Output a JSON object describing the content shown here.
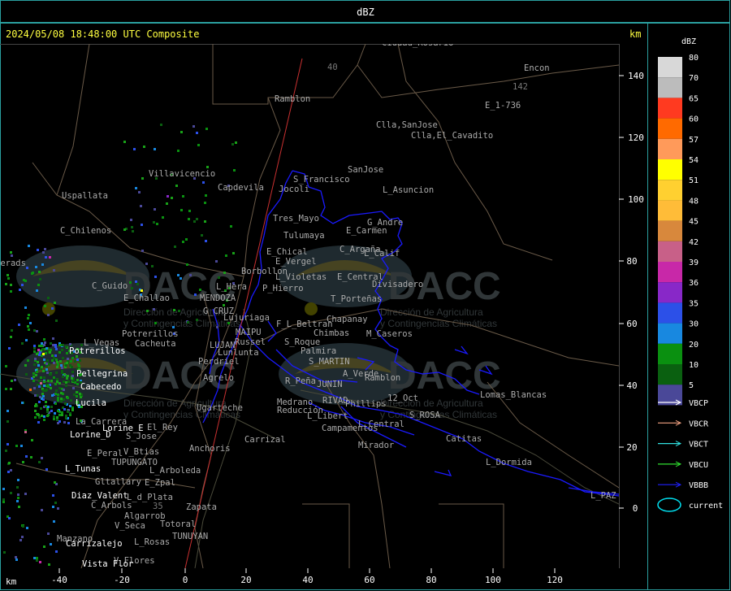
{
  "header": {
    "title": "dBZ",
    "timestamp": "2024/05/08 18:48:00 UTC Composite",
    "unit_top": "km",
    "unit_bottom": "km"
  },
  "axes": {
    "x_ticks": [
      "-40",
      "-20",
      "0",
      "20",
      "40",
      "60",
      "80",
      "100",
      "120"
    ],
    "y_ticks": [
      "140",
      "120",
      "100",
      "80",
      "60",
      "40",
      "20",
      "0"
    ]
  },
  "legend": {
    "title": "dBZ",
    "bins": [
      {
        "label": "80",
        "color": "#d8d8d8"
      },
      {
        "label": "70",
        "color": "#bcbcbc"
      },
      {
        "label": "65",
        "color": "#ff3a20"
      },
      {
        "label": "60",
        "color": "#ff6a00"
      },
      {
        "label": "57",
        "color": "#ff9a5a"
      },
      {
        "label": "54",
        "color": "#ffff00"
      },
      {
        "label": "51",
        "color": "#ffd030"
      },
      {
        "label": "48",
        "color": "#ffbc38"
      },
      {
        "label": "45",
        "color": "#d8883c"
      },
      {
        "label": "42",
        "color": "#c86088"
      },
      {
        "label": "39",
        "color": "#c828a8"
      },
      {
        "label": "36",
        "color": "#8828c8"
      },
      {
        "label": "35",
        "color": "#2c50e8"
      },
      {
        "label": "30",
        "color": "#1888e0"
      },
      {
        "label": "20",
        "color": "#0a9010"
      },
      {
        "label": "10",
        "color": "#0a6010"
      },
      {
        "label": "5",
        "color": "#4a4898"
      }
    ],
    "lines": [
      {
        "label": "VBCP",
        "color": "#ffffff"
      },
      {
        "label": "VBCR",
        "color": "#f0a080"
      },
      {
        "label": "VBCT",
        "color": "#30e0e0"
      },
      {
        "label": "VBCU",
        "color": "#30e030"
      },
      {
        "label": "VBBB",
        "color": "#2020ff"
      }
    ],
    "current_label": "current",
    "current_color": "#00e0f0"
  },
  "watermark": {
    "brand": "DACC",
    "line1": "Dirección de Agricultura",
    "line2": "y Contingencias Climáticas"
  },
  "places_white": [
    "Potrerillos",
    "Pellegrina",
    "Cabecedo",
    "Lucila",
    "Lorine_D",
    "Lorine_E",
    "L_Tunas",
    "Diaz_Valent",
    "Carrizalejo",
    "Vista_Flor"
  ],
  "places_gray": [
    "Ciudad_Rosario",
    "Encon",
    "142",
    "E_1-736",
    "Ramblon",
    "Clla,SanJose",
    "Clla,El_Cavadito",
    "SanJose",
    "S_Francisco",
    "Jocoli",
    "Villavicencio",
    "Capdevila",
    "L_Asuncion",
    "Uspallata",
    "Tres_Mayo",
    "G_Andre",
    "Tulumaya",
    "E_Carmen",
    "C_Chilenos",
    "E_Chical",
    "C_Argaña",
    "L_Calif",
    "E_Vergel",
    "Borbollon",
    "L_Violetas",
    "E_Central",
    "Divisadero",
    "C_Guido",
    "L_Hera",
    "P_Hierro",
    "E_Challao",
    "MENDOZA",
    "T_Porteñas",
    "G_CRUZ",
    "Lujuriaga",
    "Chapanay",
    "Potrerillos",
    "F_L_Beltran",
    "MAIPU",
    "Chimbas",
    "M_Caseros",
    "Cacheuta",
    "Russel",
    "S_Roque",
    "LUJAN",
    "Lunlunta",
    "Palmira",
    "L_Vegas",
    "Perdriel",
    "S_MARTIN",
    "A_Verde",
    "Agrelo",
    "R_Peña",
    "JUNIN",
    "Ramblon",
    "RIVAD",
    "Phillips",
    "12_Oct",
    "Lomas_Blancas",
    "Medrano",
    "Ugarteche",
    "Reducción",
    "L_Libert",
    "S_ROSA",
    "El_Rey",
    "L_Central",
    "Campamentos",
    "La_Carrera",
    "S_Jose",
    "Carrizal",
    "Catitas",
    "E_Peral",
    "V_Btias",
    "Anchoris",
    "Mirador",
    "TUPUNGATO",
    "L_Arboleda",
    "L_Dormida",
    "Gltallary",
    "E_Zpal",
    "L_d_Plata",
    "L_PAZ",
    "C_Arbols",
    "Zapata",
    "Algarrob",
    "V_Seca",
    "Totoral",
    "Manzano",
    "L_Rosas",
    "TUNUYAN",
    "V_Flores",
    "derads",
    "40",
    "35"
  ]
}
